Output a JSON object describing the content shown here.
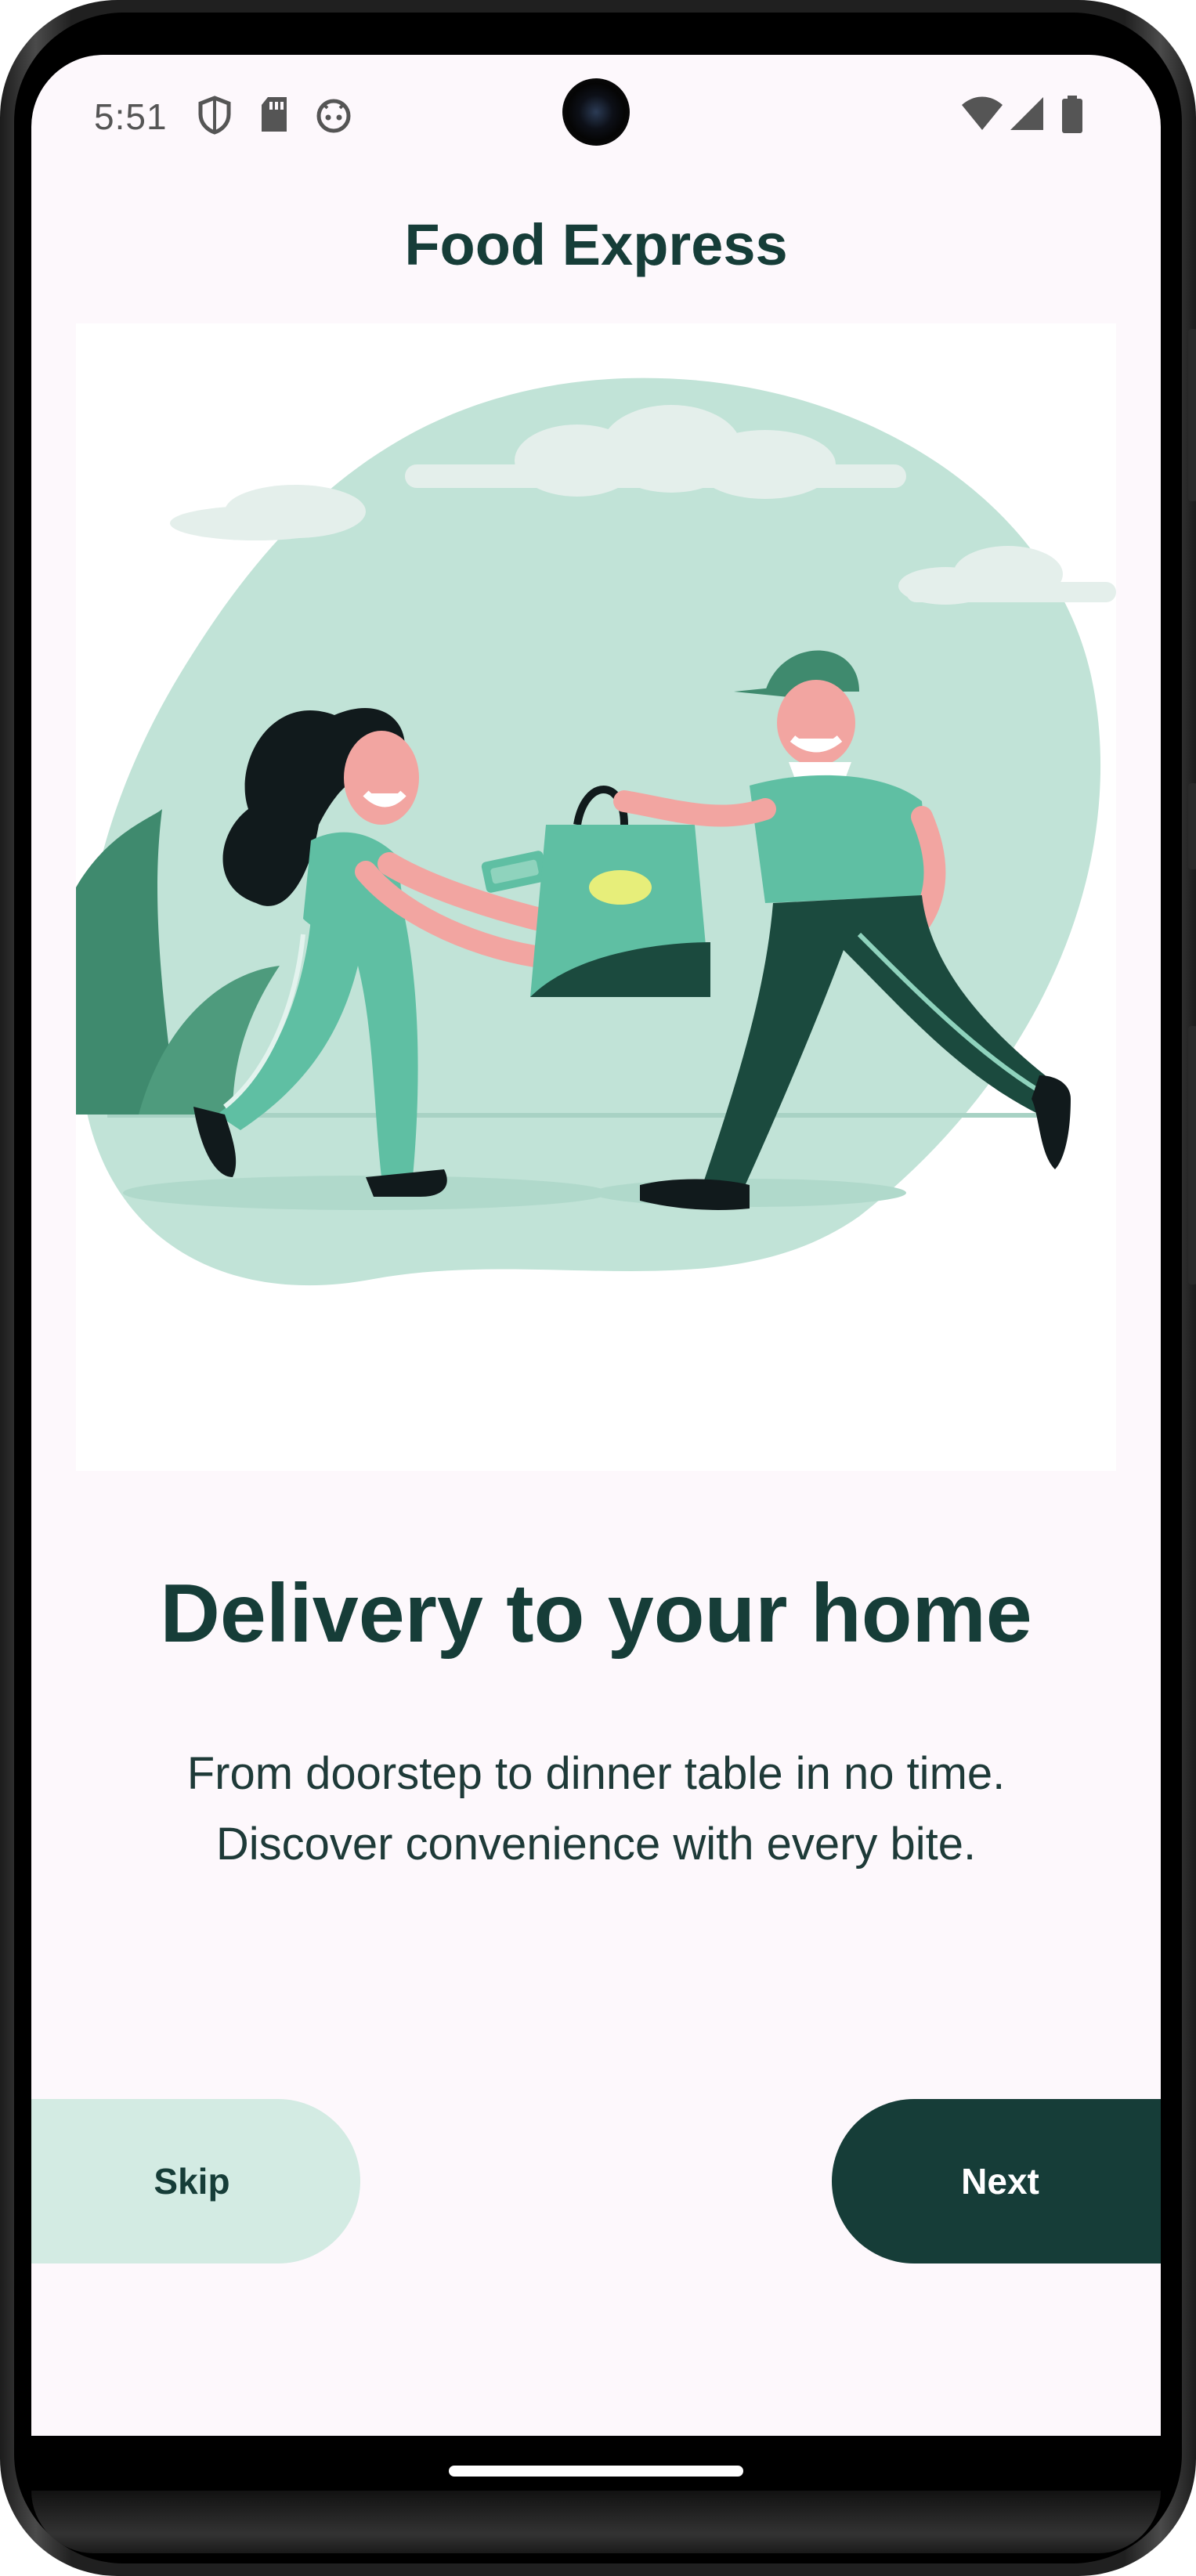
{
  "status_bar": {
    "time": "5:51",
    "left_icons": [
      "shield-icon",
      "sd-card-icon",
      "robot-face-icon"
    ],
    "right_icons": [
      "wifi-icon",
      "cell-signal-icon",
      "battery-icon"
    ]
  },
  "header": {
    "title": "Food Express"
  },
  "illustration": {
    "icon": "delivery-illustration"
  },
  "content": {
    "headline": "Delivery to your home",
    "body_line_1": "From doorstep to dinner table in no time.",
    "body_line_2": "Discover convenience with every bite."
  },
  "actions": {
    "skip_label": "Skip",
    "next_label": "Next"
  },
  "colors": {
    "primary": "#163d38",
    "secondary_container": "#d3ebe3",
    "background": "#fdf8fc",
    "illustration_mint": "#c1e3d7",
    "illustration_green": "#5fbfa3",
    "illustration_dark": "#1b4a3e"
  }
}
